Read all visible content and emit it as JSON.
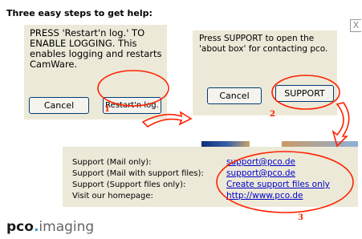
{
  "title": "Three easy steps to get help:",
  "step1": {
    "instruction": "PRESS 'Restart'n log.' TO ENABLE LOGGING. This enables logging and restarts CamWare.",
    "cancel_label": "Cancel",
    "restart_label": "Restart'n log.",
    "number": "1"
  },
  "step2": {
    "instruction": "Press SUPPORT to open the 'about box' for contacting pco.",
    "cancel_label": "Cancel",
    "support_label": "SUPPORT",
    "number": "2"
  },
  "step3": {
    "rows": [
      {
        "label": "Support (Mail only):",
        "link": "support@pco.de"
      },
      {
        "label": "Support (Mail with support files):",
        "link": "support@pco.de"
      },
      {
        "label": "Support (Support files only):",
        "link": "Create support files only"
      },
      {
        "label": "Visit our homepage:",
        "link": "http://www.pco.de"
      }
    ],
    "number": "3"
  },
  "logo": {
    "brand": "pco",
    "dot": ".",
    "sub": "imaging"
  },
  "close_icon": "X",
  "colors": {
    "annotation": "#ff2200",
    "link": "#0000cc",
    "panel": "#ece9d8",
    "logo_dot": "#2ea0d8"
  }
}
